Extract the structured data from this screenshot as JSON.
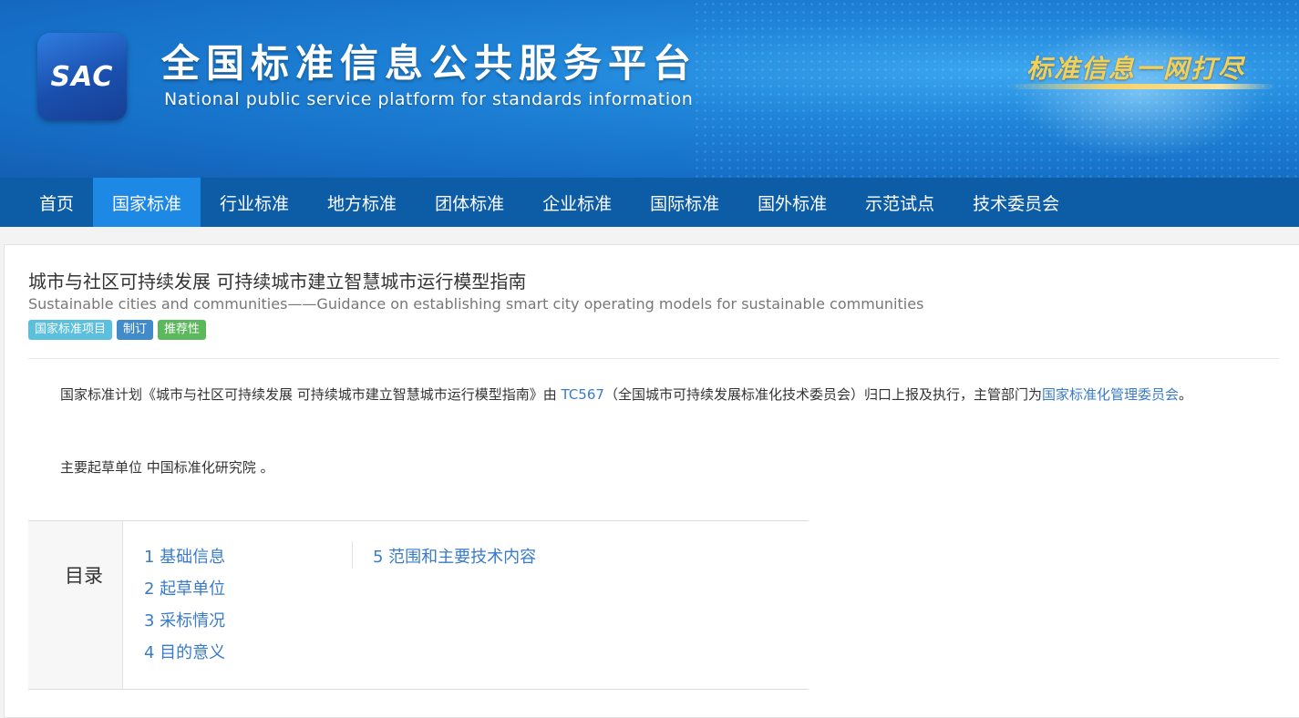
{
  "header": {
    "logo_text": "SAC",
    "title_cn": "全国标准信息公共服务平台",
    "title_en": "National public service platform  for standards information",
    "slogan": "标准信息一网打尽"
  },
  "nav": {
    "items": [
      "首页",
      "国家标准",
      "行业标准",
      "地方标准",
      "团体标准",
      "企业标准",
      "国际标准",
      "国外标准",
      "示范试点",
      "技术委员会"
    ],
    "active": "国家标准"
  },
  "doc": {
    "title_cn": "城市与社区可持续发展 可持续城市建立智慧城市运行模型指南",
    "title_en": "Sustainable cities and communities——Guidance on establishing smart city operating models for sustainable communities",
    "tags": [
      "国家标准项目",
      "制订",
      "推荐性"
    ],
    "para1": {
      "prefix": "国家标准计划《城市与社区可持续发展 可持续城市建立智慧城市运行模型指南》由 ",
      "tc_link": "TC567",
      "middle": "（全国城市可持续发展标准化技术委员会）归口上报及执行，主管部门为",
      "dept_link": "国家标准化管理委员会",
      "suffix": "。"
    },
    "para2": "主要起草单位 中国标准化研究院 。"
  },
  "toc": {
    "label": "目录",
    "col1": [
      "1  基础信息",
      "2  起草单位",
      "3  采标情况",
      "4  目的意义"
    ],
    "col2": [
      "5  范围和主要技术内容"
    ]
  }
}
